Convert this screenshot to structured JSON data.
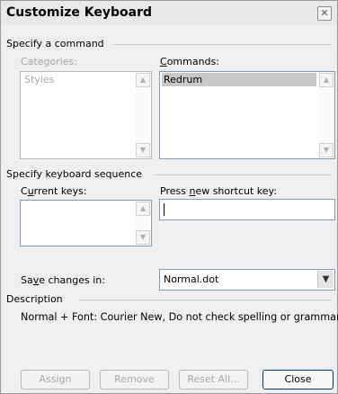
{
  "window": {
    "title": "Customize Keyboard",
    "close_glyph": "✕"
  },
  "specify_command": {
    "section_label": "Specify a command",
    "categories_label": "Categories:",
    "categories_items": [
      "Styles"
    ],
    "commands_label": "Commands:",
    "commands_items": [
      "Redrum"
    ]
  },
  "keyboard_sequence": {
    "section_label": "Specify keyboard sequence",
    "current_keys_label": "Current keys:",
    "new_key_label": "Press new shortcut key:",
    "new_key_value": ""
  },
  "save_changes": {
    "label": "Save changes in:",
    "value": "Normal.dot"
  },
  "description": {
    "section_label": "Description",
    "text": "Normal + Font: Courier New, Do not check spelling or grammar"
  },
  "buttons": {
    "assign": "Assign",
    "remove": "Remove",
    "reset_all": "Reset All...",
    "close": "Close"
  },
  "icons": {
    "scroll_up": "▲",
    "scroll_down": "▼",
    "dropdown": "▼"
  }
}
